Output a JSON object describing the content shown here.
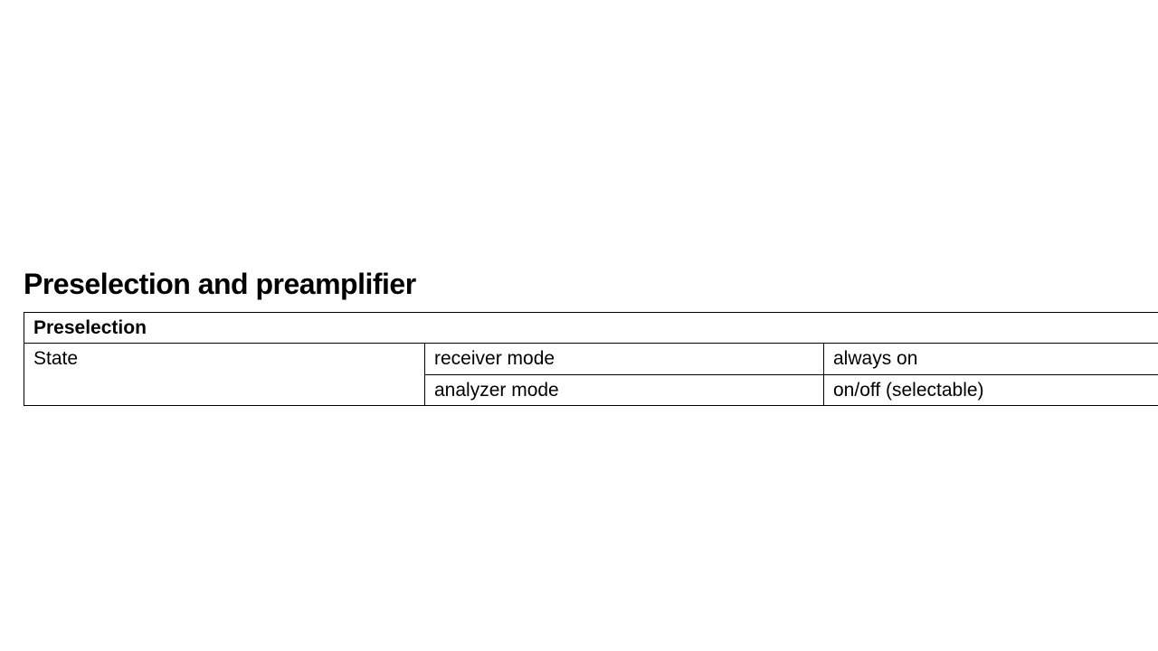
{
  "section": {
    "title": "Preselection and preamplifier"
  },
  "table": {
    "header": "Preselection",
    "rows": [
      {
        "label": "State",
        "mode": "receiver mode",
        "value": "always on"
      },
      {
        "label": "",
        "mode": "analyzer mode",
        "value": "on/off (selectable)"
      }
    ]
  }
}
